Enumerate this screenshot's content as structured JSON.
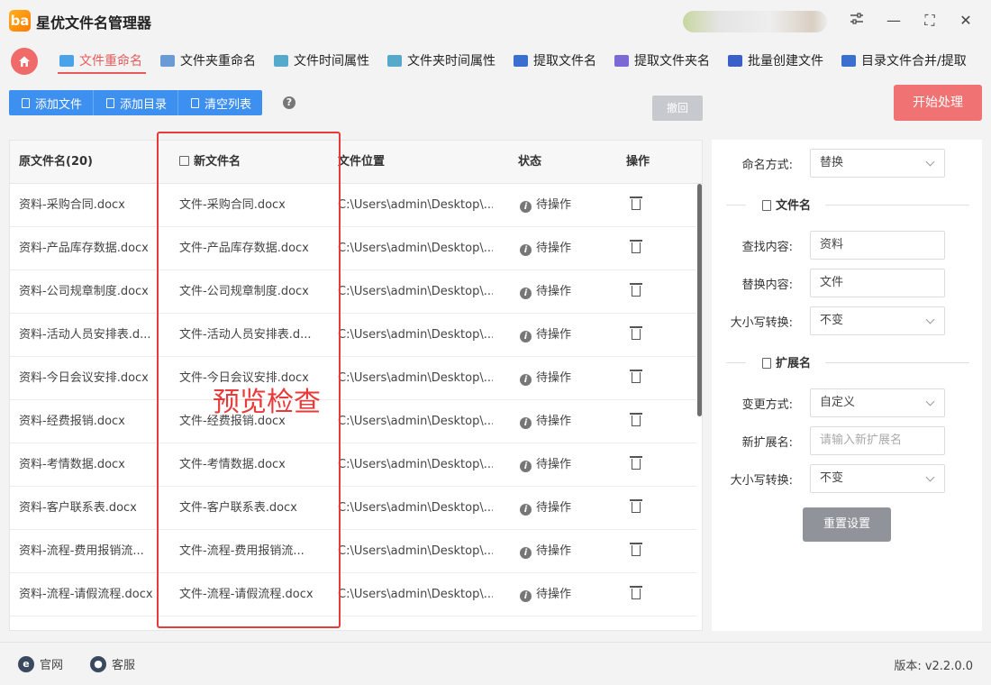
{
  "app": {
    "title": "星优文件名管理器",
    "logo": "ba"
  },
  "window": {
    "settings_icon": "sliders-icon",
    "minimize": "—",
    "maximize": "⛶",
    "close": "✕"
  },
  "tabs": [
    {
      "label": "文件重命名",
      "color": "#4aa3e8"
    },
    {
      "label": "文件夹重命名",
      "color": "#6a9bd4"
    },
    {
      "label": "文件时间属性",
      "color": "#55aacc"
    },
    {
      "label": "文件夹时间属性",
      "color": "#55aacc"
    },
    {
      "label": "提取文件名",
      "color": "#3a6fd0"
    },
    {
      "label": "提取文件夹名",
      "color": "#7b6ad6"
    },
    {
      "label": "批量创建文件",
      "color": "#3a5fc8"
    },
    {
      "label": "目录文件合并/提取",
      "color": "#3a6fd0"
    }
  ],
  "toolbar": {
    "add_file": "添加文件",
    "add_dir": "添加目录",
    "clear_list": "清空列表",
    "help": "?",
    "undo": "撤回",
    "start": "开始处理"
  },
  "table": {
    "headers": {
      "original": "原文件名(20)",
      "new": "新文件名",
      "location": "文件位置",
      "status": "状态",
      "action": "操作"
    },
    "rows": [
      {
        "original": "资料-采购合同.docx",
        "new": "文件-采购合同.docx",
        "location": "C:\\Users\\admin\\Desktop\\...",
        "status": "待操作"
      },
      {
        "original": "资料-产品库存数据.docx",
        "new": "文件-产品库存数据.docx",
        "location": "C:\\Users\\admin\\Desktop\\...",
        "status": "待操作"
      },
      {
        "original": "资料-公司规章制度.docx",
        "new": "文件-公司规章制度.docx",
        "location": "C:\\Users\\admin\\Desktop\\...",
        "status": "待操作"
      },
      {
        "original": "资料-活动人员安排表.d...",
        "new": "文件-活动人员安排表.d...",
        "location": "C:\\Users\\admin\\Desktop\\...",
        "status": "待操作"
      },
      {
        "original": "资料-今日会议安排.docx",
        "new": "文件-今日会议安排.docx",
        "location": "C:\\Users\\admin\\Desktop\\...",
        "status": "待操作"
      },
      {
        "original": "资料-经费报销.docx",
        "new": "文件-经费报销.docx",
        "location": "C:\\Users\\admin\\Desktop\\...",
        "status": "待操作"
      },
      {
        "original": "资料-考情数据.docx",
        "new": "文件-考情数据.docx",
        "location": "C:\\Users\\admin\\Desktop\\...",
        "status": "待操作"
      },
      {
        "original": "资料-客户联系表.docx",
        "new": "文件-客户联系表.docx",
        "location": "C:\\Users\\admin\\Desktop\\...",
        "status": "待操作"
      },
      {
        "original": "资料-流程-费用报销流...",
        "new": "文件-流程-费用报销流...",
        "location": "C:\\Users\\admin\\Desktop\\...",
        "status": "待操作"
      },
      {
        "original": "资料-流程-请假流程.docx",
        "new": "文件-流程-请假流程.docx",
        "location": "C:\\Users\\admin\\Desktop\\...",
        "status": "待操作"
      }
    ]
  },
  "annotation": "预览检查",
  "panel": {
    "naming_mode_label": "命名方式:",
    "naming_mode_value": "替换",
    "filename_section": "文件名",
    "find_label": "查找内容:",
    "find_value": "资料",
    "replace_label": "替换内容:",
    "replace_value": "文件",
    "case_label": "大小写转换:",
    "case_value": "不变",
    "ext_section": "扩展名",
    "change_mode_label": "变更方式:",
    "change_mode_value": "自定义",
    "new_ext_label": "新扩展名:",
    "new_ext_placeholder": "请输入新扩展名",
    "ext_case_label": "大小写转换:",
    "ext_case_value": "不变",
    "reset": "重置设置"
  },
  "footer": {
    "website": "官网",
    "website_icon": "e",
    "support": "客服",
    "version": "版本: v2.2.0.0"
  },
  "colors": {
    "accent": "#e85a5a",
    "primary": "#3d8ff0",
    "start": "#f07272",
    "annotation": "#e83a3a"
  }
}
